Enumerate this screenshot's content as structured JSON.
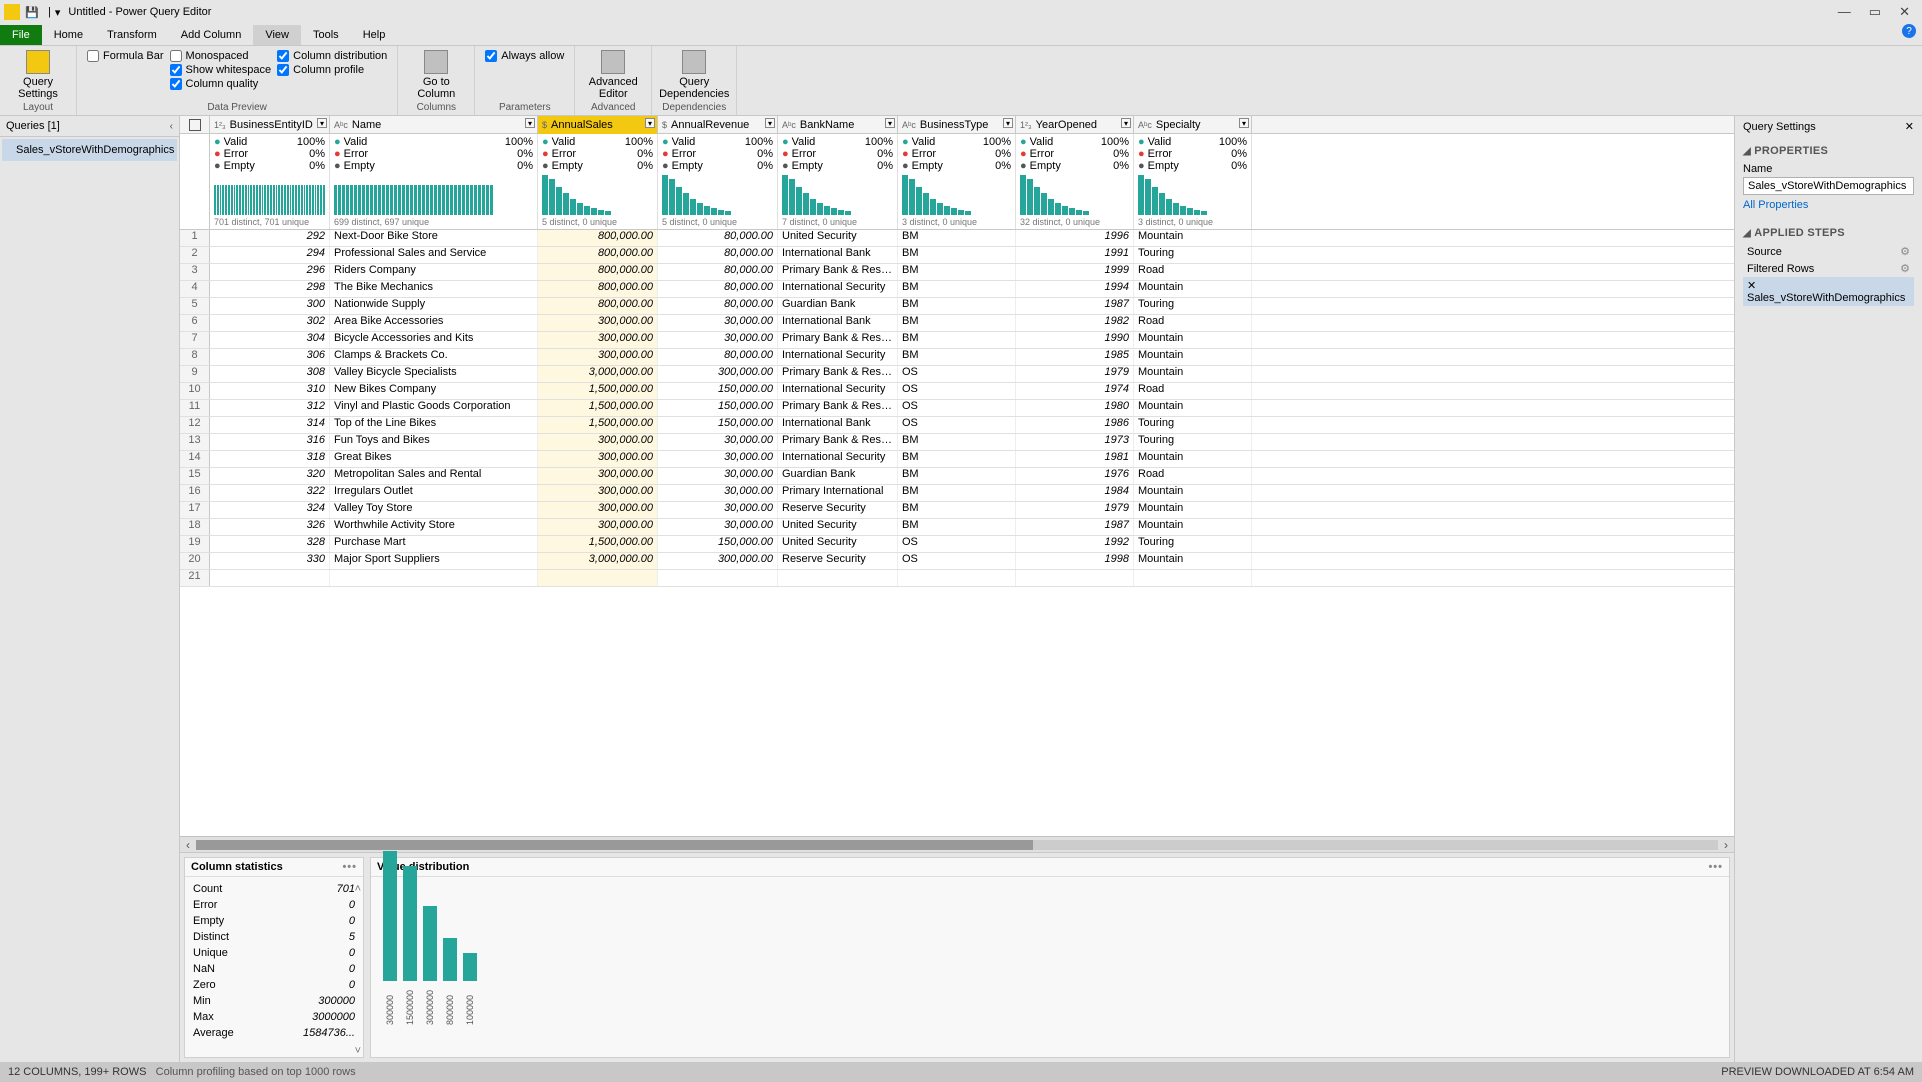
{
  "title": "Untitled - Power Query Editor",
  "menus": {
    "file": "File",
    "home": "Home",
    "transform": "Transform",
    "addcol": "Add Column",
    "view": "View",
    "tools": "Tools",
    "help": "Help"
  },
  "ribbon": {
    "query_settings": "Query\nSettings",
    "layout": "Layout",
    "formula_bar": "Formula Bar",
    "monospaced": "Monospaced",
    "col_dist": "Column distribution",
    "show_ws": "Show whitespace",
    "col_profile": "Column profile",
    "col_quality": "Column quality",
    "data_preview": "Data Preview",
    "goto_col": "Go to\nColumn",
    "columns": "Columns",
    "always_allow": "Always allow",
    "parameters": "Parameters",
    "adv_editor": "Advanced\nEditor",
    "advanced": "Advanced",
    "query_deps": "Query\nDependencies",
    "deps": "Dependencies"
  },
  "queries": {
    "title": "Queries [1]",
    "item": "Sales_vStoreWithDemographics"
  },
  "columns": [
    {
      "name": "BusinessEntityID",
      "type": "1²₃",
      "sel": false,
      "valid": "100%",
      "err": "0%",
      "emp": "0%",
      "distinct": "701 distinct, 701 unique",
      "spark": "flat"
    },
    {
      "name": "Name",
      "type": "Aᵇc",
      "sel": false,
      "valid": "100%",
      "err": "0%",
      "emp": "0%",
      "distinct": "699 distinct, 697 unique",
      "spark": "flat"
    },
    {
      "name": "AnnualSales",
      "type": "$",
      "sel": true,
      "valid": "100%",
      "err": "0%",
      "emp": "0%",
      "distinct": "5 distinct, 0 unique",
      "spark": "desc"
    },
    {
      "name": "AnnualRevenue",
      "type": "$",
      "sel": false,
      "valid": "100%",
      "err": "0%",
      "emp": "0%",
      "distinct": "5 distinct, 0 unique",
      "spark": "desc"
    },
    {
      "name": "BankName",
      "type": "Aᵇc",
      "sel": false,
      "valid": "100%",
      "err": "0%",
      "emp": "0%",
      "distinct": "7 distinct, 0 unique",
      "spark": "desc"
    },
    {
      "name": "BusinessType",
      "type": "Aᵇc",
      "sel": false,
      "valid": "100%",
      "err": "0%",
      "emp": "0%",
      "distinct": "3 distinct, 0 unique",
      "spark": "desc"
    },
    {
      "name": "YearOpened",
      "type": "1²₃",
      "sel": false,
      "valid": "100%",
      "err": "0%",
      "emp": "0%",
      "distinct": "32 distinct, 0 unique",
      "spark": "desc"
    },
    {
      "name": "Specialty",
      "type": "Aᵇc",
      "sel": false,
      "valid": "100%",
      "err": "0%",
      "emp": "0%",
      "distinct": "3 distinct, 0 unique",
      "spark": "desc"
    }
  ],
  "rows": [
    {
      "n": 1,
      "id": "292",
      "name": "Next-Door Bike Store",
      "sales": "800,000.00",
      "rev": "80,000.00",
      "bank": "United Security",
      "bt": "BM",
      "yr": "1996",
      "sp": "Mountain"
    },
    {
      "n": 2,
      "id": "294",
      "name": "Professional Sales and Service",
      "sales": "800,000.00",
      "rev": "80,000.00",
      "bank": "International Bank",
      "bt": "BM",
      "yr": "1991",
      "sp": "Touring"
    },
    {
      "n": 3,
      "id": "296",
      "name": "Riders Company",
      "sales": "800,000.00",
      "rev": "80,000.00",
      "bank": "Primary Bank & Reserve",
      "bt": "BM",
      "yr": "1999",
      "sp": "Road"
    },
    {
      "n": 4,
      "id": "298",
      "name": "The Bike Mechanics",
      "sales": "800,000.00",
      "rev": "80,000.00",
      "bank": "International Security",
      "bt": "BM",
      "yr": "1994",
      "sp": "Mountain"
    },
    {
      "n": 5,
      "id": "300",
      "name": "Nationwide Supply",
      "sales": "800,000.00",
      "rev": "80,000.00",
      "bank": "Guardian Bank",
      "bt": "BM",
      "yr": "1987",
      "sp": "Touring"
    },
    {
      "n": 6,
      "id": "302",
      "name": "Area Bike Accessories",
      "sales": "300,000.00",
      "rev": "30,000.00",
      "bank": "International Bank",
      "bt": "BM",
      "yr": "1982",
      "sp": "Road"
    },
    {
      "n": 7,
      "id": "304",
      "name": "Bicycle Accessories and Kits",
      "sales": "300,000.00",
      "rev": "30,000.00",
      "bank": "Primary Bank & Reserve",
      "bt": "BM",
      "yr": "1990",
      "sp": "Mountain"
    },
    {
      "n": 8,
      "id": "306",
      "name": "Clamps & Brackets Co.",
      "sales": "300,000.00",
      "rev": "80,000.00",
      "bank": "International Security",
      "bt": "BM",
      "yr": "1985",
      "sp": "Mountain"
    },
    {
      "n": 9,
      "id": "308",
      "name": "Valley Bicycle Specialists",
      "sales": "3,000,000.00",
      "rev": "300,000.00",
      "bank": "Primary Bank & Reserve",
      "bt": "OS",
      "yr": "1979",
      "sp": "Mountain"
    },
    {
      "n": 10,
      "id": "310",
      "name": "New Bikes Company",
      "sales": "1,500,000.00",
      "rev": "150,000.00",
      "bank": "International Security",
      "bt": "OS",
      "yr": "1974",
      "sp": "Road"
    },
    {
      "n": 11,
      "id": "312",
      "name": "Vinyl and Plastic Goods Corporation",
      "sales": "1,500,000.00",
      "rev": "150,000.00",
      "bank": "Primary Bank & Reserve",
      "bt": "OS",
      "yr": "1980",
      "sp": "Mountain"
    },
    {
      "n": 12,
      "id": "314",
      "name": "Top of the Line Bikes",
      "sales": "1,500,000.00",
      "rev": "150,000.00",
      "bank": "International Bank",
      "bt": "OS",
      "yr": "1986",
      "sp": "Touring"
    },
    {
      "n": 13,
      "id": "316",
      "name": "Fun Toys and Bikes",
      "sales": "300,000.00",
      "rev": "30,000.00",
      "bank": "Primary Bank & Reserve",
      "bt": "BM",
      "yr": "1973",
      "sp": "Touring"
    },
    {
      "n": 14,
      "id": "318",
      "name": "Great Bikes",
      "sales": "300,000.00",
      "rev": "30,000.00",
      "bank": "International Security",
      "bt": "BM",
      "yr": "1981",
      "sp": "Mountain"
    },
    {
      "n": 15,
      "id": "320",
      "name": "Metropolitan Sales and Rental",
      "sales": "300,000.00",
      "rev": "30,000.00",
      "bank": "Guardian Bank",
      "bt": "BM",
      "yr": "1976",
      "sp": "Road"
    },
    {
      "n": 16,
      "id": "322",
      "name": "Irregulars Outlet",
      "sales": "300,000.00",
      "rev": "30,000.00",
      "bank": "Primary International",
      "bt": "BM",
      "yr": "1984",
      "sp": "Mountain"
    },
    {
      "n": 17,
      "id": "324",
      "name": "Valley Toy Store",
      "sales": "300,000.00",
      "rev": "30,000.00",
      "bank": "Reserve Security",
      "bt": "BM",
      "yr": "1979",
      "sp": "Mountain"
    },
    {
      "n": 18,
      "id": "326",
      "name": "Worthwhile Activity Store",
      "sales": "300,000.00",
      "rev": "30,000.00",
      "bank": "United Security",
      "bt": "BM",
      "yr": "1987",
      "sp": "Mountain"
    },
    {
      "n": 19,
      "id": "328",
      "name": "Purchase Mart",
      "sales": "1,500,000.00",
      "rev": "150,000.00",
      "bank": "United Security",
      "bt": "OS",
      "yr": "1992",
      "sp": "Touring"
    },
    {
      "n": 20,
      "id": "330",
      "name": "Major Sport Suppliers",
      "sales": "3,000,000.00",
      "rev": "300,000.00",
      "bank": "Reserve Security",
      "bt": "OS",
      "yr": "1998",
      "sp": "Mountain"
    },
    {
      "n": 21,
      "id": "",
      "name": "",
      "sales": "",
      "rev": "",
      "bank": "",
      "bt": "",
      "yr": "",
      "sp": ""
    }
  ],
  "stats": {
    "title": "Column statistics",
    "items": [
      {
        "k": "Count",
        "v": "701"
      },
      {
        "k": "Error",
        "v": "0"
      },
      {
        "k": "Empty",
        "v": "0"
      },
      {
        "k": "Distinct",
        "v": "5"
      },
      {
        "k": "Unique",
        "v": "0"
      },
      {
        "k": "NaN",
        "v": "0"
      },
      {
        "k": "Zero",
        "v": "0"
      },
      {
        "k": "Min",
        "v": "300000"
      },
      {
        "k": "Max",
        "v": "3000000"
      },
      {
        "k": "Average",
        "v": "1584736..."
      }
    ]
  },
  "dist": {
    "title": "Value distribution"
  },
  "chart_data": {
    "type": "bar",
    "categories": [
      "300000",
      "1500000",
      "3000000",
      "800000",
      "100000"
    ],
    "values": [
      260,
      230,
      150,
      85,
      55
    ],
    "title": "Value distribution"
  },
  "settings": {
    "title": "Query Settings",
    "properties": "PROPERTIES",
    "name_lbl": "Name",
    "name_val": "Sales_vStoreWithDemographics",
    "all_props": "All Properties",
    "applied": "APPLIED STEPS",
    "steps": [
      "Source",
      "Filtered Rows",
      "Sales_vStoreWithDemographics"
    ]
  },
  "status": {
    "left": "12 COLUMNS, 199+ ROWS",
    "mid": "Column profiling based on top 1000 rows",
    "right": "PREVIEW DOWNLOADED AT 6:54 AM"
  }
}
